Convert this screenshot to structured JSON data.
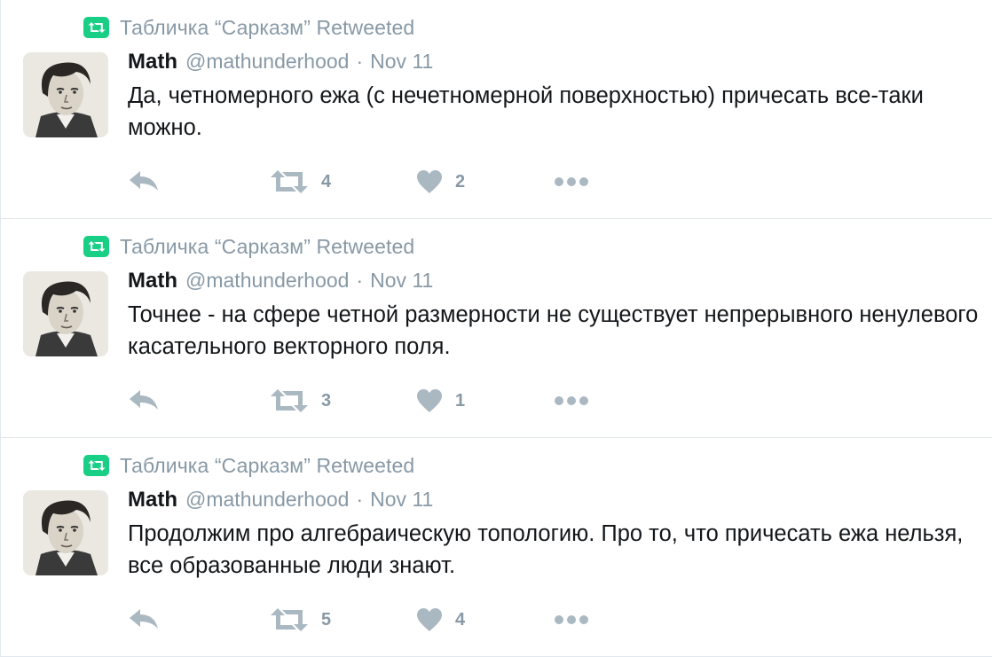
{
  "tweets": [
    {
      "context": "Табличка “Сарказм” Retweeted",
      "name": "Math",
      "handle": "@mathunderhood",
      "separator": "·",
      "date": "Nov 11",
      "text": "Да, четномерного ежа (с нечетномерной поверхностью) причесать все-таки можно.",
      "retweets": "4",
      "likes": "2"
    },
    {
      "context": "Табличка “Сарказм” Retweeted",
      "name": "Math",
      "handle": "@mathunderhood",
      "separator": "·",
      "date": "Nov 11",
      "text": "Точнее - на сфере четной размерности не существует непрерывного ненулевого касательного векторного поля.",
      "retweets": "3",
      "likes": "1"
    },
    {
      "context": "Табличка “Сарказм” Retweeted",
      "name": "Math",
      "handle": "@mathunderhood",
      "separator": "·",
      "date": "Nov 11",
      "text": "Продолжим про алгебраическую топологию. Про то, что причесать ежа нельзя, все образованные люди знают.",
      "retweets": "5",
      "likes": "4"
    }
  ],
  "icons": {
    "retweet_badge": "retweet-icon",
    "reply": "reply-icon",
    "retweet": "retweet-icon",
    "like": "heart-icon",
    "more": "more-icon"
  },
  "colors": {
    "retweet_green": "#19cf86",
    "muted": "#8899a6",
    "icon_grey": "#aab8c2",
    "text": "#14171a"
  }
}
